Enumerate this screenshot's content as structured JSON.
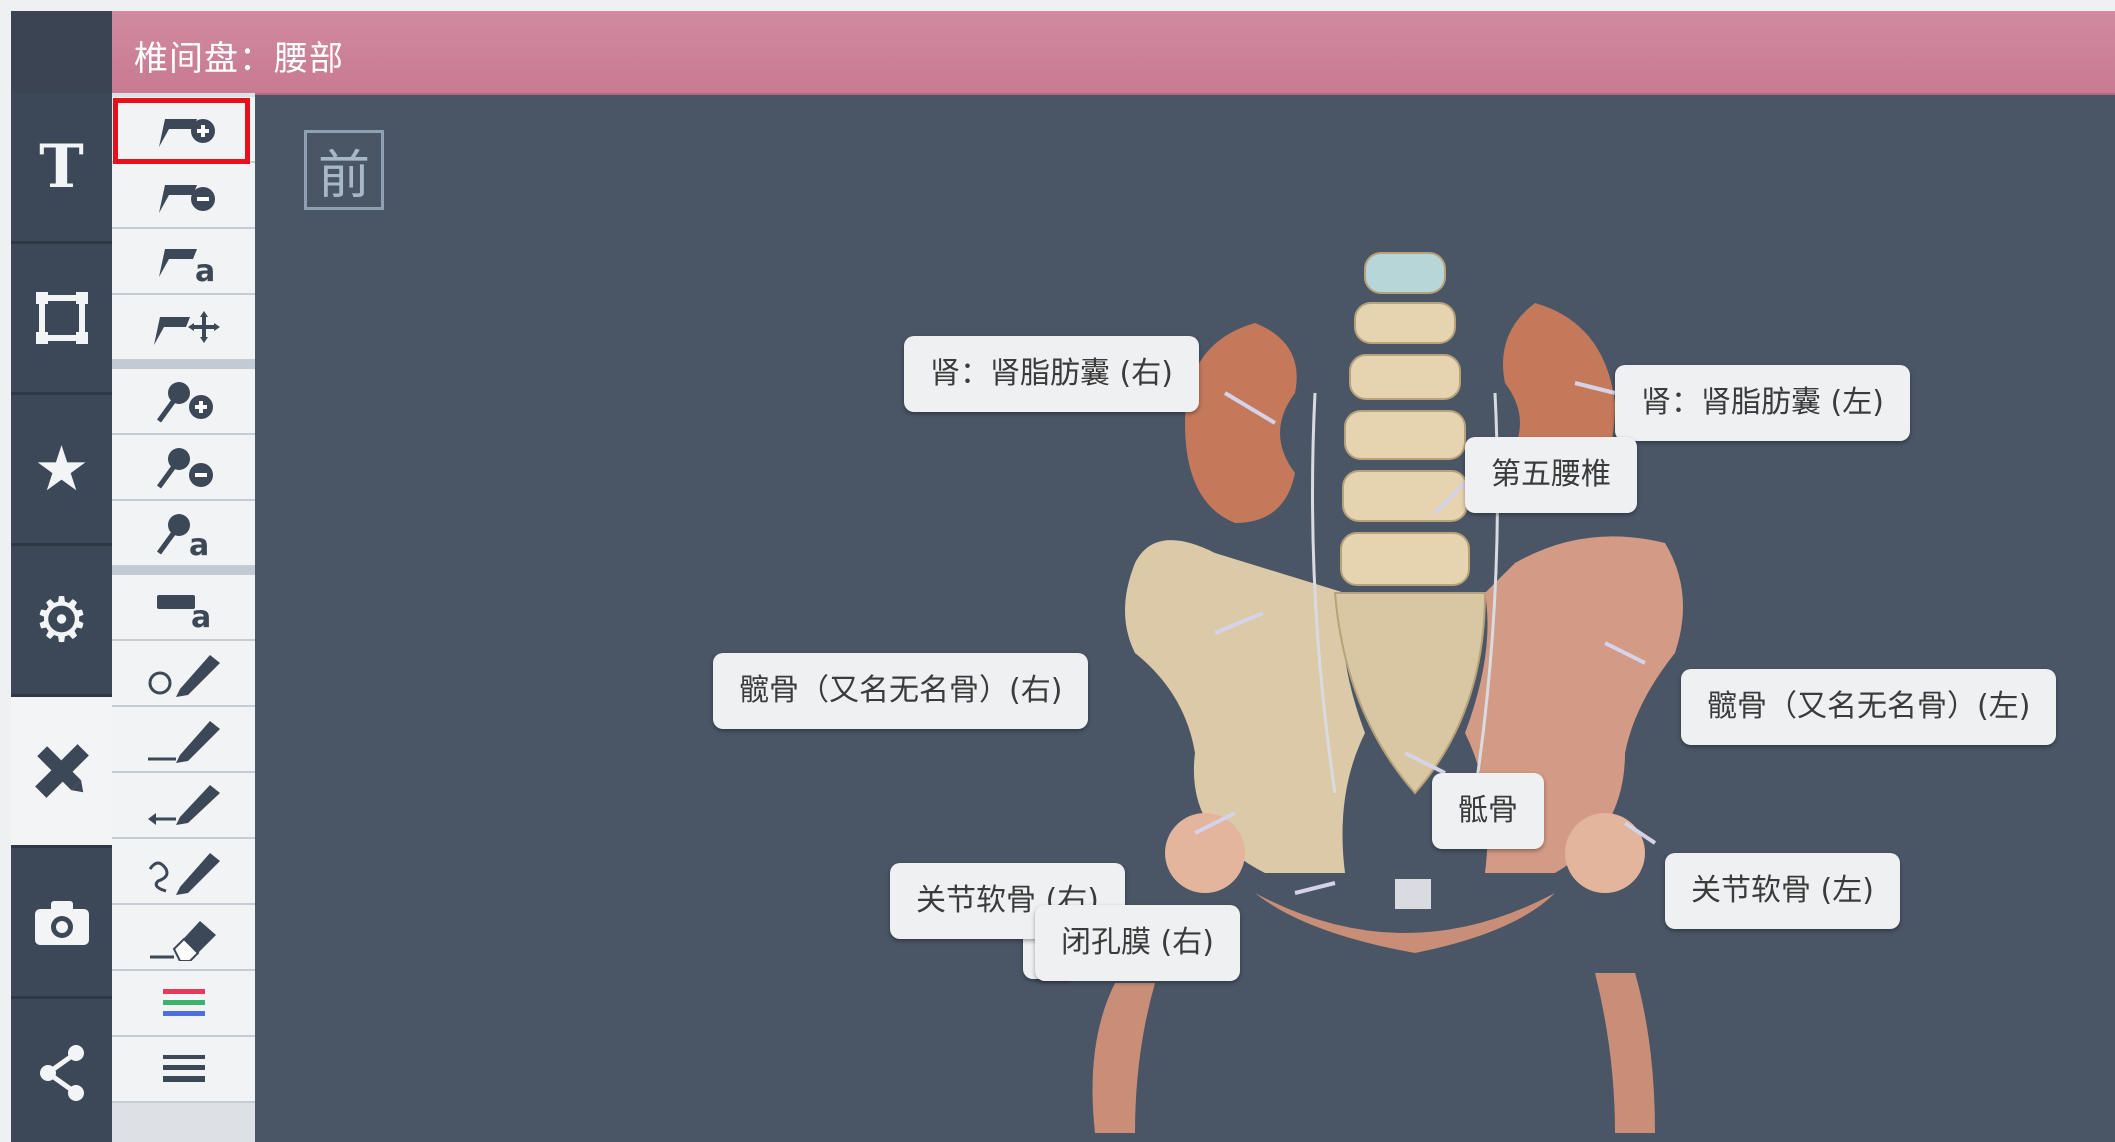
{
  "window": {
    "title": "椎间盘：腰部"
  },
  "left_nav": [
    {
      "name": "text",
      "glyph": "T",
      "icon": "text-icon",
      "active": false
    },
    {
      "name": "select",
      "glyph": "",
      "icon": "selection-frame-icon",
      "active": false
    },
    {
      "name": "favorites",
      "glyph": "★",
      "icon": "star-icon",
      "active": false
    },
    {
      "name": "settings",
      "glyph": "⚙",
      "icon": "gear-icon",
      "active": false
    },
    {
      "name": "tools",
      "glyph": "",
      "icon": "pencil-ruler-icon",
      "active": true
    },
    {
      "name": "camera",
      "glyph": "",
      "icon": "camera-icon",
      "active": false
    },
    {
      "name": "share",
      "glyph": "",
      "icon": "share-icon",
      "active": false
    }
  ],
  "tools": [
    {
      "icon": "add-pin-label-icon",
      "selected": true
    },
    {
      "icon": "remove-pin-label-icon"
    },
    {
      "icon": "text-pin-label-icon"
    },
    {
      "icon": "move-pin-label-icon"
    },
    {
      "icon": "add-point-label-icon"
    },
    {
      "icon": "remove-point-label-icon"
    },
    {
      "icon": "text-point-label-icon"
    },
    {
      "icon": "text-box-icon"
    },
    {
      "icon": "draw-circle-icon"
    },
    {
      "icon": "draw-line-icon"
    },
    {
      "icon": "draw-arrow-icon"
    },
    {
      "icon": "freehand-draw-icon"
    },
    {
      "icon": "eraser-icon"
    },
    {
      "icon": "color-palette-icon"
    },
    {
      "icon": "line-weight-icon"
    }
  ],
  "view": {
    "orientation_button": "前"
  },
  "labels": {
    "kidney_right": "肾：肾脂肪囊 (右)",
    "kidney_left": "肾：肾脂肪囊 (左)",
    "l5": "第五腰椎",
    "hip_right": "髋骨（又名无名骨）(右)",
    "hip_left": "髋骨（又名无名骨）(左)",
    "sacrum": "骶骨",
    "cartilage_right": "关节软骨 (右)",
    "cartilage_left": "关节软骨 (左)",
    "obturator_right": "闭孔膜 (右)"
  },
  "colors": {
    "title_bar": "#c87a91",
    "background": "#4a5666",
    "highlight": "#e8101a"
  }
}
